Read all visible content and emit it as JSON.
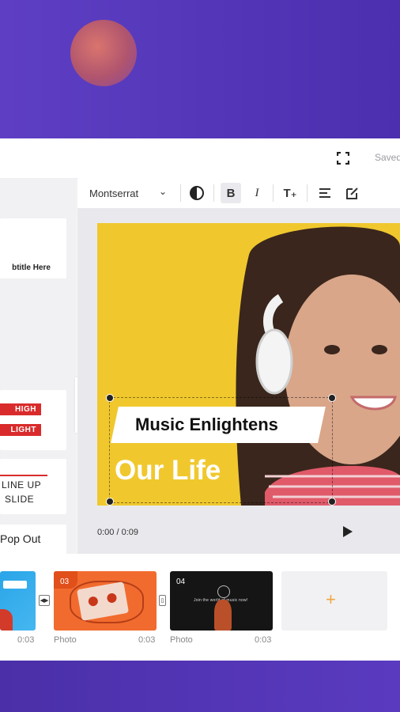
{
  "app": {
    "saved_label": "Saved",
    "toolbar": {
      "font_name": "Montserrat",
      "bold_label": "B",
      "italic_label": "I",
      "text_size_label": "T₊"
    },
    "left_panel": {
      "card1_text": "btitle Here",
      "card2_tag1": "HIGH",
      "card2_tag2": "LIGHT",
      "card3_line1": "LINE UP",
      "card3_line2": "SLIDE",
      "card4_text": "Pop Out"
    },
    "preview": {
      "banner_text": "Music Enlightens",
      "big_text": "Our Life",
      "time": "0:00 / 0:09"
    },
    "timeline": {
      "clips": [
        {
          "label": "",
          "duration": "0:03"
        },
        {
          "number": "03",
          "label": "Photo",
          "duration": "0:03"
        },
        {
          "number": "04",
          "label": "Photo",
          "duration": "0:03",
          "caption": "Join the world of music now!"
        }
      ],
      "add_label": "+"
    }
  },
  "colors": {
    "brand_purple": "#5536b3",
    "accent_orange": "#f0a640",
    "canvas_yellow": "#f0c82e",
    "tag_red": "#d92b2b"
  },
  "icons": [
    "fullscreen-icon",
    "chevron-down-icon",
    "contrast-icon",
    "bold-icon",
    "italic-icon",
    "text-size-icon",
    "align-icon",
    "edit-icon",
    "collapse-chevron-icon",
    "cursor-icon",
    "play-icon",
    "transition-icon",
    "add-icon"
  ]
}
